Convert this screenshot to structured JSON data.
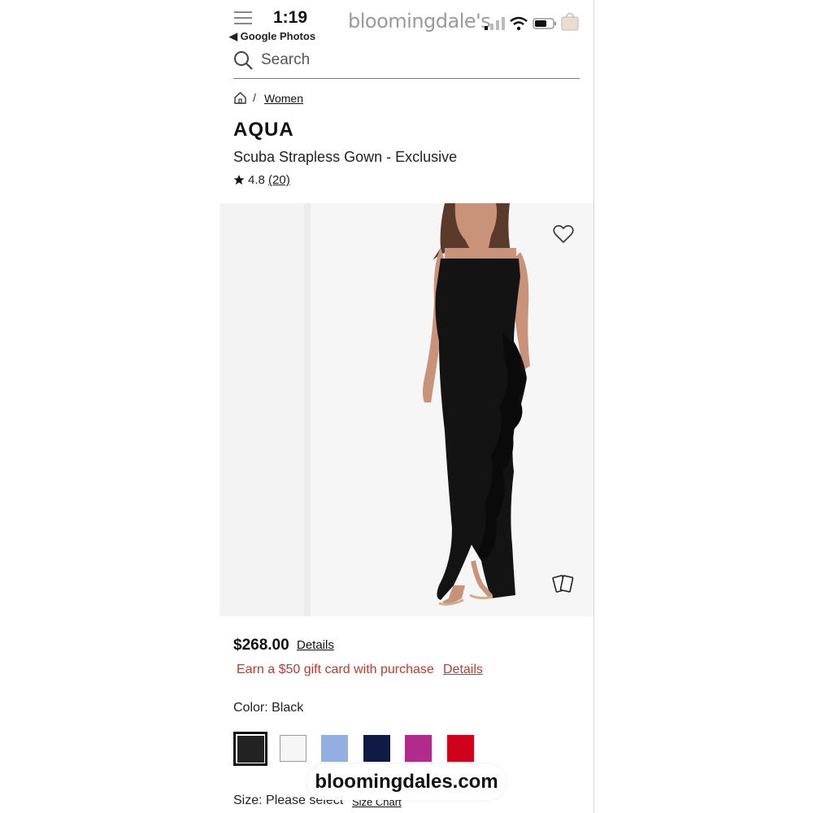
{
  "status_bar": {
    "time": "1:19",
    "back_app": "◀ Google Photos",
    "brand_logo": "bloomingdale's"
  },
  "search": {
    "placeholder": "Search"
  },
  "breadcrumb": {
    "separator": "/",
    "link": "Women"
  },
  "product": {
    "brand": "AQUA",
    "name": "Scuba Strapless Gown - Exclusive",
    "rating": "4.8",
    "review_count": "(20)",
    "price": "$268.00",
    "price_details_link": "Details",
    "promo_text": "Earn a $50 gift card with purchase",
    "promo_details_link": "Details",
    "color_label": "Color: Black",
    "colors": [
      {
        "name": "Black",
        "hex": "#222222",
        "selected": true
      },
      {
        "name": "White",
        "hex": "#f6f6f6",
        "selected": false
      },
      {
        "name": "Light Blue",
        "hex": "#93aee0",
        "selected": false
      },
      {
        "name": "Navy",
        "hex": "#0f1a45",
        "selected": false
      },
      {
        "name": "Magenta",
        "hex": "#b02b8c",
        "selected": false
      },
      {
        "name": "Red",
        "hex": "#d0021b",
        "selected": false
      }
    ],
    "size_label": "Size: Please select",
    "size_chart_link": "Size Chart"
  },
  "watermark": "bloomingdales.com",
  "colors": {
    "promo_red": "#c0392b",
    "text": "#111111"
  }
}
